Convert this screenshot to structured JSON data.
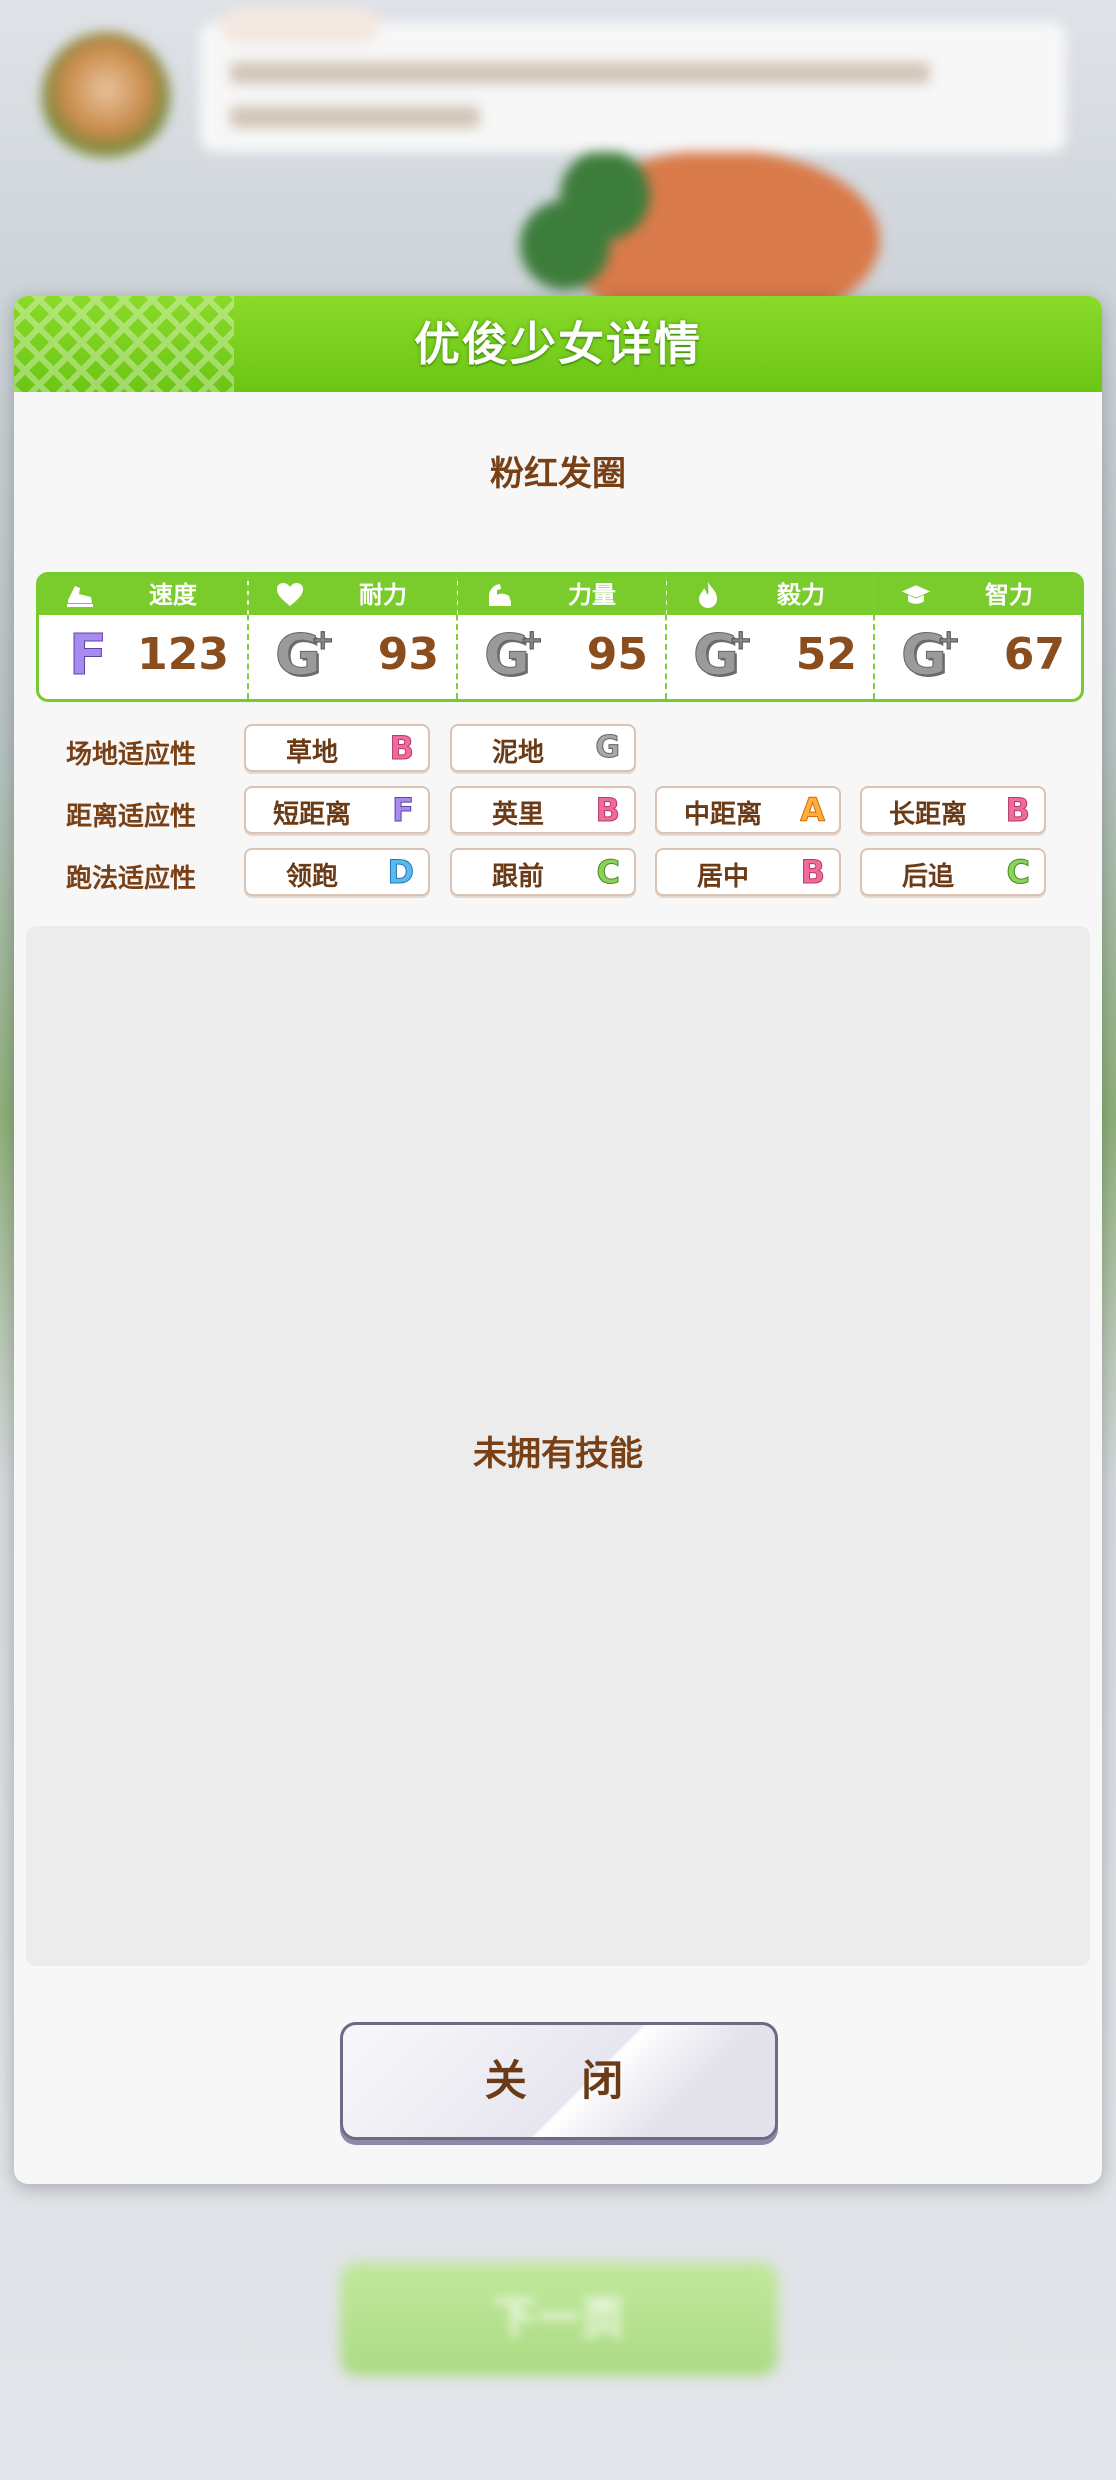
{
  "dialog": {
    "title": "优俊少女详情",
    "item_name": "粉红发圈",
    "close_label": "关 闭"
  },
  "stats": [
    {
      "label": "速度",
      "icon": "shoe-icon",
      "rank": "F",
      "plus": false,
      "value": "123"
    },
    {
      "label": "耐力",
      "icon": "heart-icon",
      "rank": "G",
      "plus": true,
      "value": "93"
    },
    {
      "label": "力量",
      "icon": "muscle-icon",
      "rank": "G",
      "plus": true,
      "value": "95"
    },
    {
      "label": "毅力",
      "icon": "flame-icon",
      "rank": "G",
      "plus": true,
      "value": "52"
    },
    {
      "label": "智力",
      "icon": "graduation-cap-icon",
      "rank": "G",
      "plus": true,
      "value": "67"
    }
  ],
  "aptitude": {
    "track": {
      "label": "场地适应性",
      "items": [
        {
          "name": "草地",
          "grade": "B"
        },
        {
          "name": "泥地",
          "grade": "G"
        }
      ]
    },
    "distance": {
      "label": "距离适应性",
      "items": [
        {
          "name": "短距离",
          "grade": "F"
        },
        {
          "name": "英里",
          "grade": "B"
        },
        {
          "name": "中距离",
          "grade": "A"
        },
        {
          "name": "长距离",
          "grade": "B"
        }
      ]
    },
    "style": {
      "label": "跑法适应性",
      "items": [
        {
          "name": "领跑",
          "grade": "D"
        },
        {
          "name": "跟前",
          "grade": "C"
        },
        {
          "name": "居中",
          "grade": "B"
        },
        {
          "name": "后追",
          "grade": "C"
        }
      ]
    }
  },
  "skills": {
    "empty_text": "未拥有技能"
  },
  "background": {
    "next_button_label": "下一页"
  }
}
